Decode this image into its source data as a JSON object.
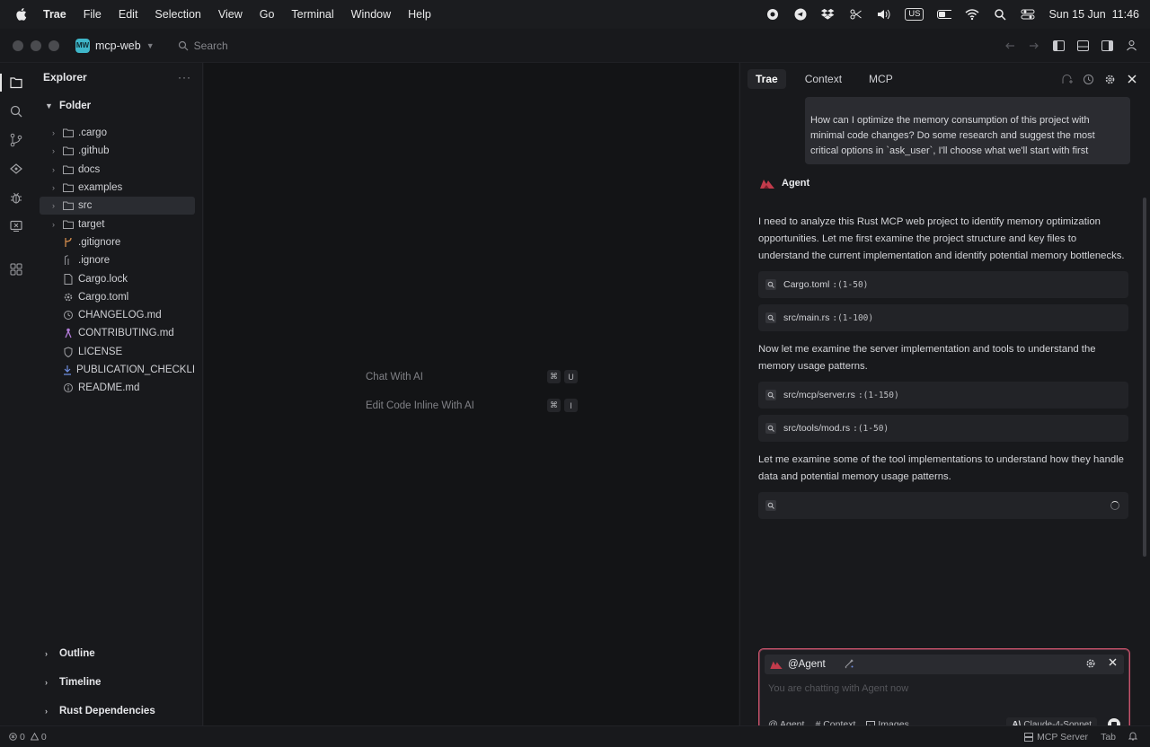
{
  "menubar": {
    "app": "Trae",
    "items": [
      "File",
      "Edit",
      "Selection",
      "View",
      "Go",
      "Terminal",
      "Window",
      "Help"
    ],
    "keyboard": "US",
    "datetime": "Sun 15 Jun  11:46"
  },
  "titlebar": {
    "project_badge": "MW",
    "project_name": "mcp-web",
    "search_placeholder": "Search"
  },
  "sidebar": {
    "title": "Explorer",
    "more": "···",
    "folder_label": "Folder",
    "items": [
      {
        "label": ".cargo",
        "kind": "folder"
      },
      {
        "label": ".github",
        "kind": "folder"
      },
      {
        "label": "docs",
        "kind": "folder"
      },
      {
        "label": "examples",
        "kind": "folder"
      },
      {
        "label": "src",
        "kind": "folder",
        "selected": true
      },
      {
        "label": "target",
        "kind": "folder"
      },
      {
        "label": ".gitignore",
        "kind": "file",
        "icon": "git-icon"
      },
      {
        "label": ".ignore",
        "kind": "file",
        "icon": "ignore-file-icon"
      },
      {
        "label": "Cargo.lock",
        "kind": "file",
        "icon": "file-icon"
      },
      {
        "label": "Cargo.toml",
        "kind": "file",
        "icon": "gear-icon"
      },
      {
        "label": "CHANGELOG.md",
        "kind": "file",
        "icon": "clock-icon"
      },
      {
        "label": "CONTRIBUTING.md",
        "kind": "file",
        "icon": "person-icon"
      },
      {
        "label": "LICENSE",
        "kind": "file",
        "icon": "shield-icon"
      },
      {
        "label": "PUBLICATION_CHECKLI...",
        "kind": "file",
        "icon": "download-icon"
      },
      {
        "label": "README.md",
        "kind": "file",
        "icon": "info-icon"
      }
    ],
    "sections": [
      "Outline",
      "Timeline",
      "Rust Dependencies"
    ]
  },
  "editor": {
    "hints": [
      {
        "label": "Chat With AI",
        "keys": [
          "⌘",
          "U"
        ]
      },
      {
        "label": "Edit Code Inline With AI",
        "keys": [
          "⌘",
          "I"
        ]
      }
    ]
  },
  "chat": {
    "tabs": [
      "Trae",
      "Context",
      "MCP"
    ],
    "user_message": "How can I optimize the memory consumption of this project with minimal code changes? Do some research and suggest the most critical options in `ask_user`, I'll choose what we'll start with first",
    "agent_name": "Agent",
    "para1": "I need to analyze this Rust MCP web project to identify memory optimization opportunities. Let me first examine the project structure and key files to understand the current implementation and identify potential memory bottlenecks.",
    "tool1": {
      "file": "Cargo.toml",
      "range": ":(1-50)"
    },
    "tool2": {
      "file": "src/main.rs",
      "range": ":(1-100)"
    },
    "para2": "Now let me examine the server implementation and tools to understand the memory usage patterns.",
    "tool3": {
      "file": "src/mcp/server.rs",
      "range": ":(1-150)"
    },
    "tool4": {
      "file": "src/tools/mod.rs",
      "range": ":(1-50)"
    },
    "para3": "Let me examine some of the tool implementations to understand how they handle data and potential memory usage patterns.",
    "composer": {
      "mention": "@Agent",
      "placeholder": "You are chatting with Agent now",
      "chips": [
        "@ Agent",
        "# Context",
        "Images"
      ],
      "model": "Claude-4-Sonnet"
    }
  },
  "statusbar": {
    "errors": "0",
    "warnings": "0",
    "mcp": "MCP Server",
    "tab": "Tab"
  },
  "colors": {
    "accent_border": "#c9526a",
    "project_badge": "#3fb6c9",
    "agent_logo": "#c23b4b"
  }
}
